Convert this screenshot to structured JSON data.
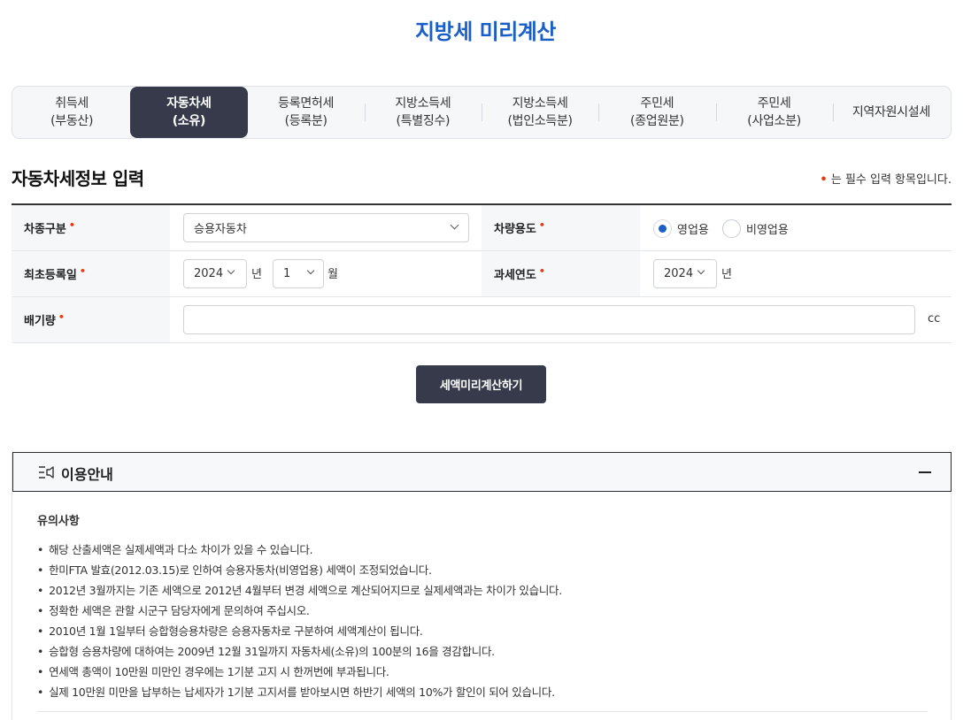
{
  "page_title": "지방세 미리계산",
  "tabs": [
    {
      "label": "취득세\n(부동산)"
    },
    {
      "label": "자동차세\n(소유)"
    },
    {
      "label": "등록면허세\n(등록분)"
    },
    {
      "label": "지방소득세\n(특별징수)"
    },
    {
      "label": "지방소득세\n(법인소득분)"
    },
    {
      "label": "주민세\n(종업원분)"
    },
    {
      "label": "주민세\n(사업소분)"
    },
    {
      "label": "지역자원시설세"
    }
  ],
  "active_tab": "자동차세 (소유)",
  "section": {
    "title": "자동차세정보 입력",
    "required_mark": "•",
    "required_note": "는 필수 입력 항목입니다."
  },
  "form": {
    "vehicle_type": {
      "label": "차종구분",
      "value": "승용자동차"
    },
    "usage": {
      "label": "차량용도",
      "options": [
        "영업용",
        "비영업용"
      ],
      "selected": "영업용"
    },
    "first_registration": {
      "label": "최초등록일",
      "year": "2024",
      "year_unit": "년",
      "month": "1",
      "month_unit": "월"
    },
    "tax_year": {
      "label": "과세연도",
      "year": "2024",
      "year_unit": "년"
    },
    "displacement": {
      "label": "배기량",
      "value": "",
      "unit": "cc"
    }
  },
  "calc_button": "세액미리계산하기",
  "guide": {
    "title": "이용안내",
    "notice_title": "유의사항",
    "notes": [
      "해당 산출세액은 실제세액과 다소 차이가 있을 수 있습니다.",
      "한미FTA 발효(2012.03.15)로 인하여 승용자동차(비영업용) 세액이 조정되었습니다.",
      "2012년 3월까지는 기존 세액으로 2012년 4월부터 변경 세액으로 계산되어지므로 실제세액과는 차이가 있습니다.",
      "정확한 세액은 관할 시군구 담당자에게 문의하여 주십시오.",
      "2010년 1월 1일부터 승합형승용차량은 승용자동차로 구분하여 세액계산이 됩니다.",
      "승합형 승용차량에 대하여는 2009년 12월 31일까지 자동차세(소유)의 100분의 16을 경감합니다.",
      "연세액 총액이 10만원 미만인 경우에는 1기분 고지 시 한꺼번에 부과됩니다.",
      "실제 10만원 미만을 납부하는 납세자가 1기분 고지서를 받아보시면 하반기 세액의 10%가 할인이 되어 있습니다."
    ]
  },
  "colors": {
    "accent": "#1a5fc8",
    "dark": "#373a4a",
    "required": "#e8380d"
  },
  "icons": {
    "guide": "megaphone-icon",
    "collapse": "minus-icon",
    "dropdown": "chevron-down-icon"
  }
}
